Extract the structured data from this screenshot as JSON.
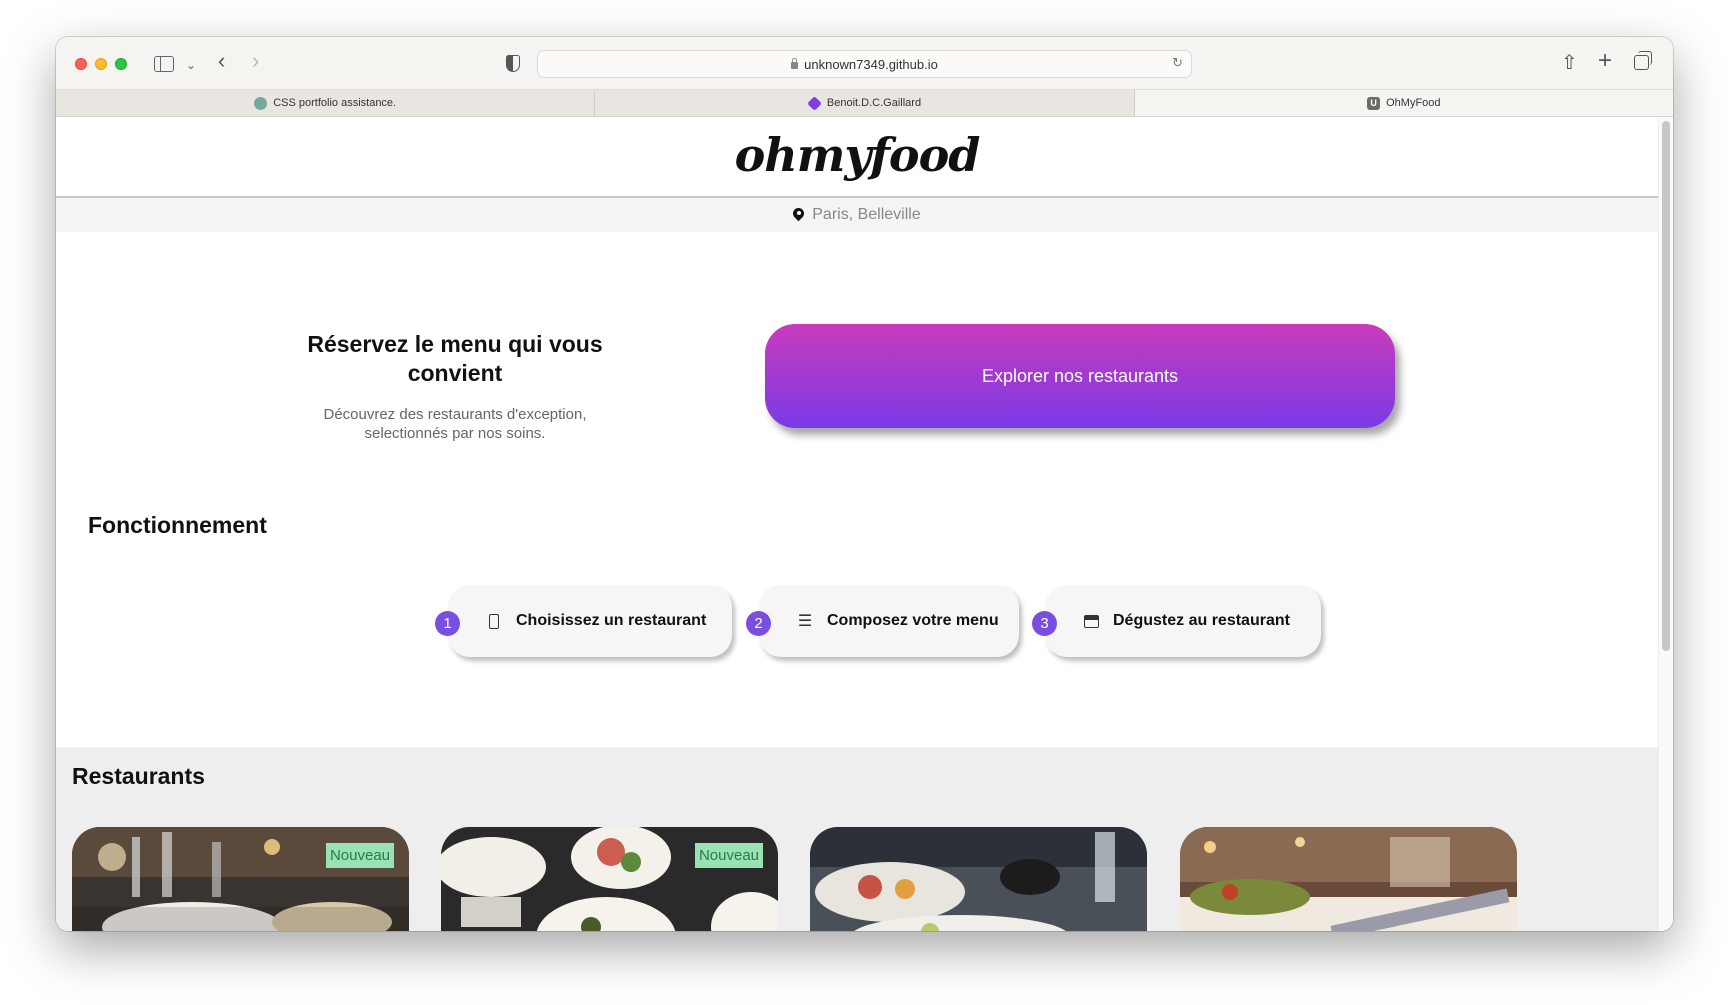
{
  "browser": {
    "url": "unknown7349.github.io",
    "tabs": [
      {
        "label": "CSS portfolio assistance.",
        "icon": "openai-icon",
        "active": false
      },
      {
        "label": "Benoit.D.C.Gaillard",
        "icon": "layers-icon",
        "active": false
      },
      {
        "label": "OhMyFood",
        "icon": "u-icon",
        "active": true
      }
    ]
  },
  "site": {
    "logo": "ohmyfood",
    "location": "Paris, Belleville"
  },
  "hero": {
    "title": "Réservez le menu qui vous convient",
    "subtitle": "Découvrez des restaurants d'exception, selectionnés par nos soins.",
    "cta_label": "Explorer nos restaurants"
  },
  "how": {
    "title": "Fonctionnement",
    "steps": [
      {
        "number": "1",
        "label": "Choisissez un restaurant",
        "icon": "phone-icon"
      },
      {
        "number": "2",
        "label": "Composez votre menu",
        "icon": "list-icon"
      },
      {
        "number": "3",
        "label": "Dégustez au restaurant",
        "icon": "store-icon"
      }
    ]
  },
  "restaurants": {
    "title": "Restaurants",
    "cards": [
      {
        "badge": "Nouveau"
      },
      {
        "badge": "Nouveau"
      },
      {
        "badge": ""
      },
      {
        "badge": ""
      }
    ]
  },
  "colors": {
    "accent_top": "#c93bbc",
    "accent_bottom": "#7a3ae6",
    "badge_bg": "#99e2b4",
    "step_number": "#7a4fe0"
  }
}
